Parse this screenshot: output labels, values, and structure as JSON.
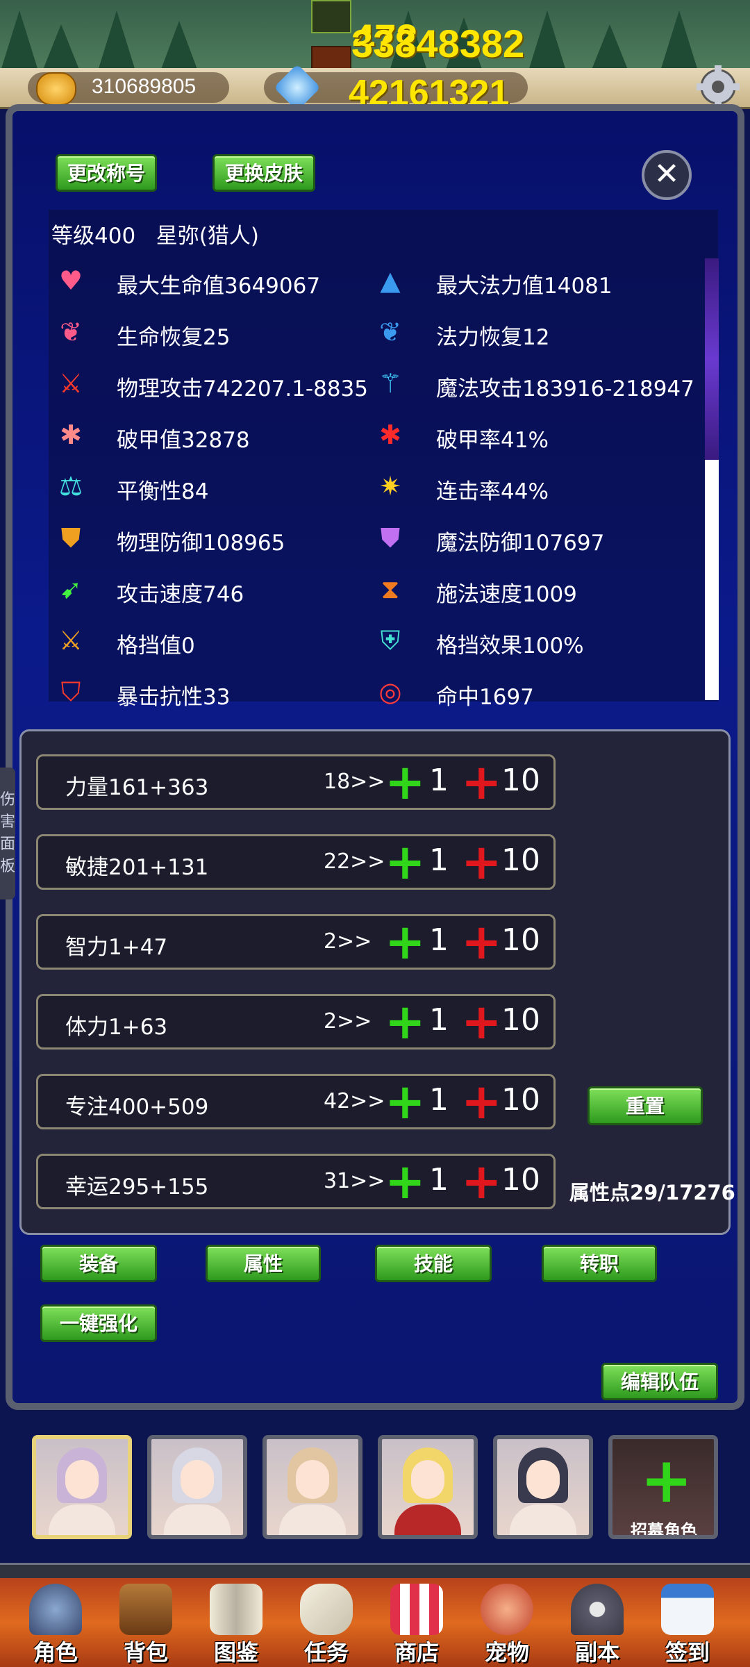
{
  "top_floats": {
    "line1": "472",
    "line2": "33848382",
    "line3": "72"
  },
  "currency": {
    "gold": "310689805",
    "gems": "42161321"
  },
  "header_buttons": {
    "change_title": "更改称号",
    "change_skin": "更换皮肤",
    "close": "✕"
  },
  "character": {
    "summary": "等级400   星弥(猎人)"
  },
  "stats_left": [
    "最大生命值3649067",
    "生命恢复25",
    "物理攻击742207.1-8835",
    "破甲值32878",
    "平衡性84",
    "物理防御108965",
    "攻击速度746",
    "格挡值0",
    "暴击抗性33"
  ],
  "stats_right": [
    "最大法力值14081",
    "法力恢复12",
    "魔法攻击183916-218947",
    "破甲率41%",
    "连击率44%",
    "魔法防御107697",
    "施法速度1009",
    "格挡效果100%",
    "命中1697"
  ],
  "attributes": [
    {
      "name": "力量161+363",
      "next": "18>>"
    },
    {
      "name": "敏捷201+131",
      "next": "22>>"
    },
    {
      "name": "智力1+47",
      "next": "2>>"
    },
    {
      "name": "体力1+63",
      "next": "2>>"
    },
    {
      "name": "专注400+509",
      "next": "42>>"
    },
    {
      "name": "幸运295+155",
      "next": "31>>"
    }
  ],
  "attr_controls": {
    "plus_small": "1",
    "plus_large": "10"
  },
  "reset_button": "重置",
  "attribute_points": "属性点29/17276",
  "side_tab": [
    "伤",
    "害",
    "面",
    "板"
  ],
  "tabs": {
    "equip": "装备",
    "attributes": "属性",
    "skills": "技能",
    "class_change": "转职",
    "one_click_enhance": "一键强化",
    "edit_team": "编辑队伍"
  },
  "recruit_label": "招募角色",
  "nav": [
    "角色",
    "背包",
    "图鉴",
    "任务",
    "商店",
    "宠物",
    "副本",
    "签到"
  ],
  "colors": {
    "green_button": "#4cc02e",
    "plus_green": "#31d61a",
    "plus_red": "#e0181e",
    "panel_blue": "#0b1a8a"
  }
}
